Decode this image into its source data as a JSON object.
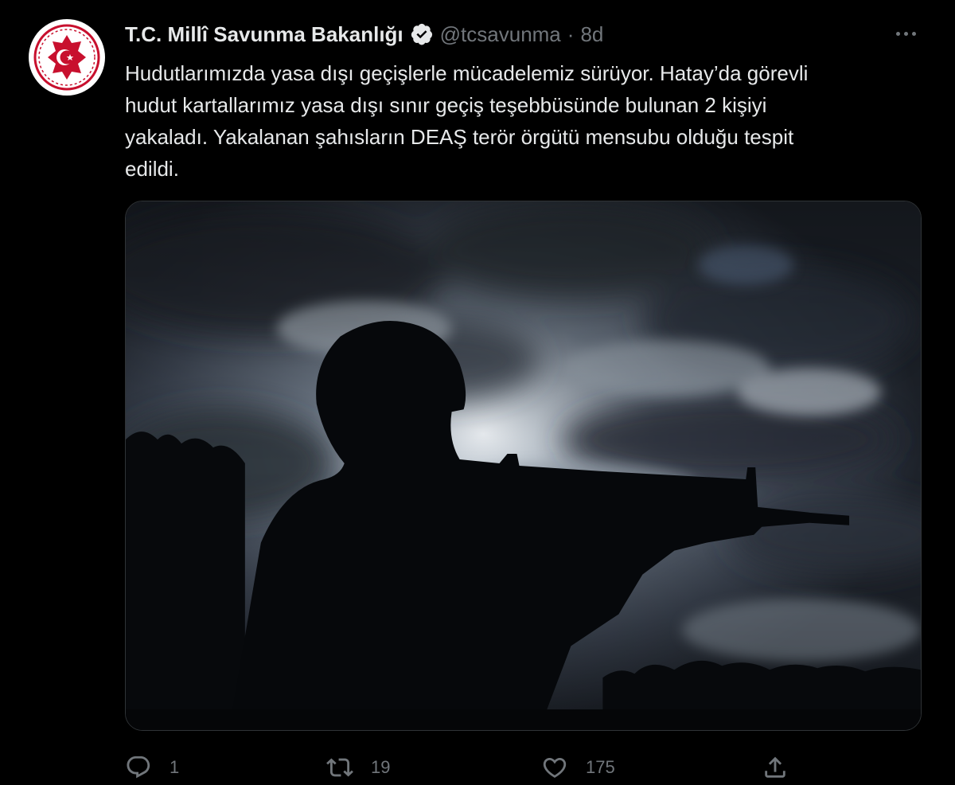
{
  "tweet": {
    "author_name": "T.C. Millî Savunma Bakanlığı",
    "handle": "@tcsavunma",
    "separator": "·",
    "time": "8d",
    "text": "Hudutlarımızda yasa dışı geçişlerle mücadelemiz sürüyor. Hatay’da görevli\nhudut kartallarımız yasa dışı sınır geçiş teşebbüsünde bulunan 2 kişiyi\nyakaladı. Yakalanan şahısların DEAŞ terör örgütü mensubu olduğu tespit\nedildi.",
    "media_description_icon": "photo"
  },
  "actions": {
    "reply_count": "1",
    "retweet_count": "19",
    "like_count": "175"
  },
  "icons": {
    "avatar": "ministry-emblem-icon",
    "verified": "verified-badge-icon",
    "more": "more-options-icon",
    "reply": "reply-icon",
    "retweet": "retweet-icon",
    "like": "heart-icon",
    "share": "share-icon"
  },
  "colors": {
    "background": "#000000",
    "text_primary": "#e7e9ea",
    "text_secondary": "#71767b",
    "emblem_red": "#c8102e"
  }
}
